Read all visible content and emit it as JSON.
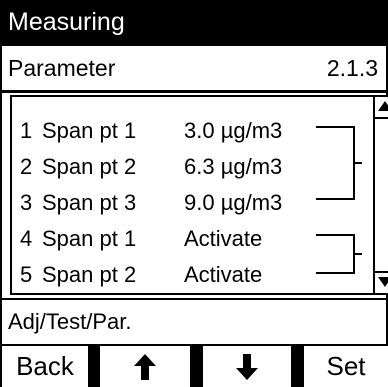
{
  "title": "Measuring",
  "header": {
    "label": "Parameter",
    "code": "2.1.3"
  },
  "list": {
    "items": [
      {
        "num": "1",
        "name": "Span pt 1",
        "value": "3.0 µg/m3"
      },
      {
        "num": "2",
        "name": "Span pt 2",
        "value": "6.3 µg/m3"
      },
      {
        "num": "3",
        "name": "Span pt 3",
        "value": "9.0 µg/m3"
      },
      {
        "num": "4",
        "name": "Span pt 1",
        "value": "Activate"
      },
      {
        "num": "5",
        "name": "Span pt 2",
        "value": "Activate"
      }
    ]
  },
  "status": {
    "text": "Adj/Test/Par."
  },
  "softkeys": {
    "back": "Back",
    "up_icon": "arrow-up-icon",
    "down_icon": "arrow-down-icon",
    "set": "Set"
  },
  "colors": {
    "background": "#000000",
    "panel": "#ffffff",
    "text": "#000000"
  }
}
